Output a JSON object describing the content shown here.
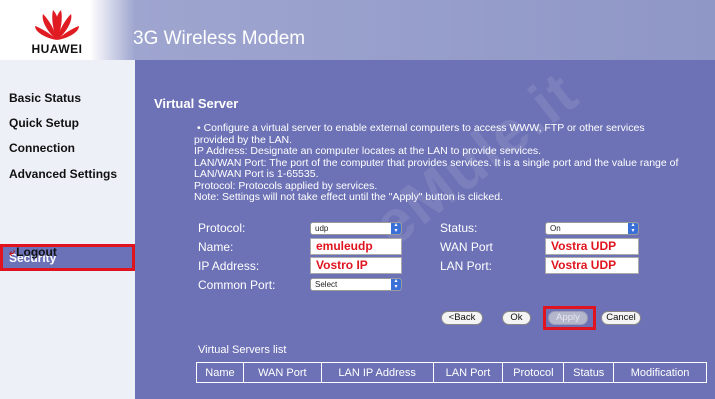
{
  "header": {
    "brand": "HUAWEI",
    "title": "3G Wireless Modem"
  },
  "sidebar": {
    "items": [
      {
        "label": "Basic Status"
      },
      {
        "label": "Quick Setup"
      },
      {
        "label": "Connection"
      },
      {
        "label": "Advanced Settings"
      },
      {
        "label": "Security",
        "selected": true
      }
    ],
    "logout": "Logout"
  },
  "main": {
    "title": "Virtual Server",
    "description": [
      "•  Configure a virtual server to enable external computers to access WWW, FTP or other services",
      "provided by the LAN.",
      "IP Address: Designate an computer locates at the LAN to provide services.",
      "LAN/WAN Port: The port of the computer that provides services. It is a single port and the value range of",
      "LAN/WAN Port is 1-65535.",
      "Protocol: Protocols applied by services.",
      "Note: Settings will not take effect until the \"Apply\" button is clicked."
    ],
    "watermark": "eMule.it",
    "form": {
      "protocol_label": "Protocol:",
      "protocol_value": "udp",
      "name_label": "Name:",
      "name_value": "emuleudp",
      "ip_label": "IP Address:",
      "ip_value": "Vostro IP",
      "common_port_label": "Common Port:",
      "common_port_value": "Select",
      "status_label": "Status:",
      "status_value": "On",
      "wan_port_label": "WAN Port",
      "wan_port_value": "Vostra UDP",
      "lan_port_label": "LAN Port:",
      "lan_port_value": "Vostra UDP"
    },
    "buttons": {
      "back": "<Back",
      "ok": "Ok",
      "apply": "Apply",
      "cancel": "Cancel"
    },
    "list": {
      "title": "Virtual Servers list",
      "columns": [
        "Name",
        "WAN Port",
        "LAN IP Address",
        "LAN Port",
        "Protocol",
        "Status",
        "Modification"
      ]
    }
  },
  "colors": {
    "main_bg": "#6d72b6",
    "sidebar_bg": "#eef0f8",
    "highlight": "#e0141e"
  }
}
